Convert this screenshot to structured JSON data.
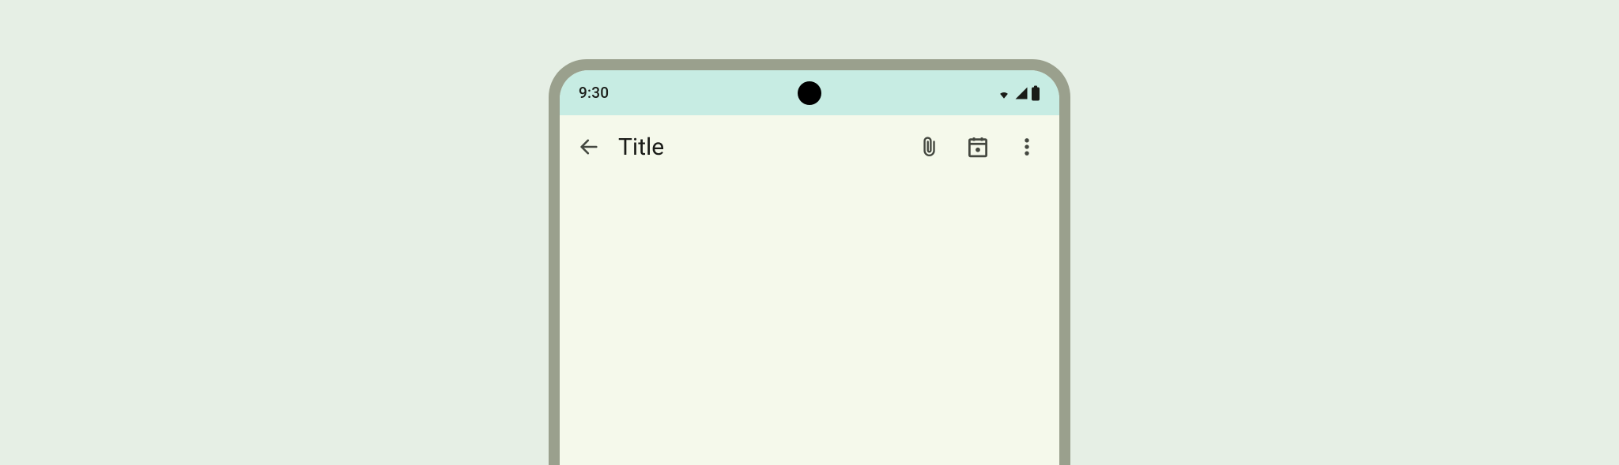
{
  "status": {
    "time": "9:30"
  },
  "appBar": {
    "title": "Title"
  },
  "icons": {
    "back": "arrow-back",
    "attach": "attachment",
    "calendar": "calendar-event",
    "more": "more-vert",
    "wifi": "wifi",
    "signal": "cellular-signal",
    "battery": "battery-full"
  }
}
